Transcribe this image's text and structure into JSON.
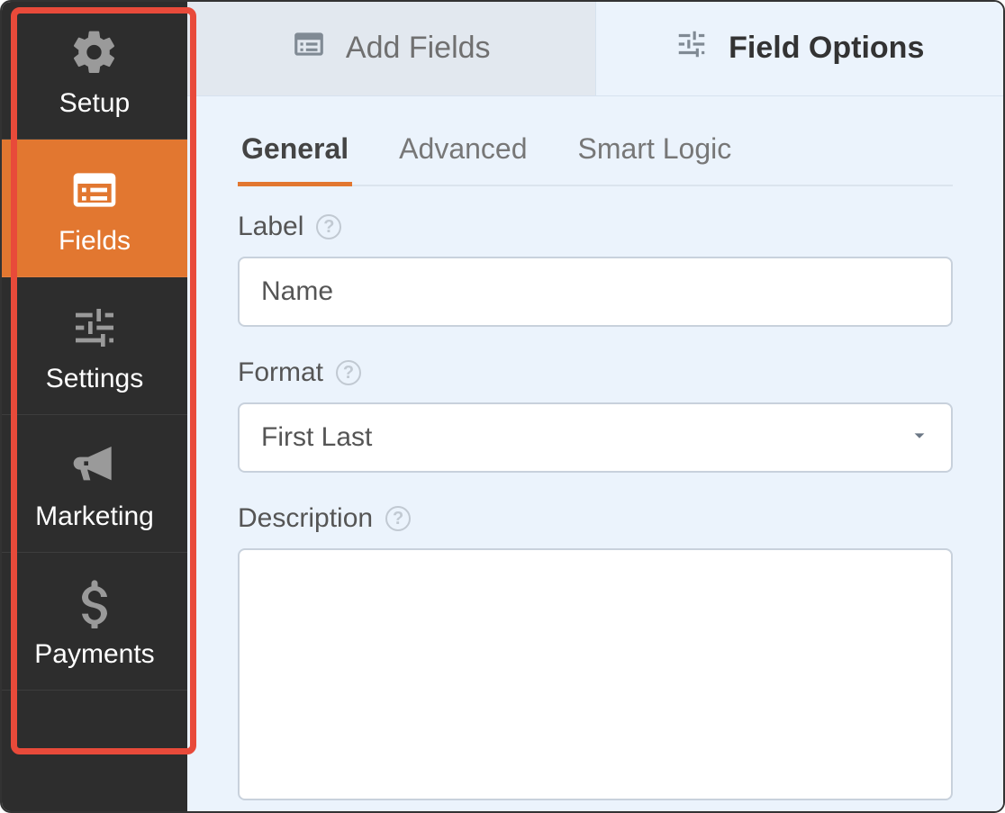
{
  "sidebar": {
    "items": [
      {
        "label": "Setup"
      },
      {
        "label": "Fields"
      },
      {
        "label": "Settings"
      },
      {
        "label": "Marketing"
      },
      {
        "label": "Payments"
      }
    ],
    "active_index": 1
  },
  "top_tabs": {
    "items": [
      {
        "label": "Add Fields"
      },
      {
        "label": "Field Options"
      }
    ],
    "active_index": 1
  },
  "sub_tabs": {
    "items": [
      {
        "label": "General"
      },
      {
        "label": "Advanced"
      },
      {
        "label": "Smart Logic"
      }
    ],
    "active_index": 0
  },
  "form": {
    "label": {
      "title": "Label",
      "value": "Name"
    },
    "format": {
      "title": "Format",
      "selected": "First Last"
    },
    "description": {
      "title": "Description",
      "value": ""
    }
  }
}
